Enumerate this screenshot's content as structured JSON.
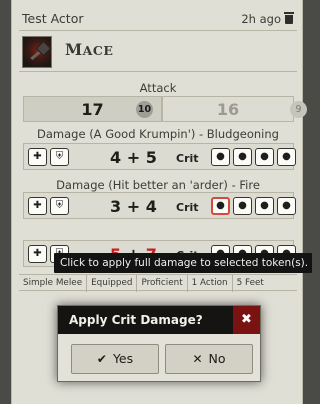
{
  "header": {
    "actor": "Test Actor",
    "time": "2h ago"
  },
  "item": {
    "name_first": "M",
    "name_rest": "ACE"
  },
  "attack": {
    "label": "Attack",
    "roll1_total": "17",
    "roll1_die": "10",
    "roll2_total": "16",
    "roll2_die": "9"
  },
  "damage1": {
    "label": "Damage (A Good Krumpin') - Bludgeoning",
    "total_a": "4",
    "total_b": "5",
    "crit_label": "Crit"
  },
  "damage2": {
    "label": "Damage (Hit better an 'arder) - Fire",
    "total_a": "3",
    "total_b": "4",
    "crit_label": "Crit"
  },
  "damage3": {
    "total_a": "5",
    "total_b": "7",
    "crit_label": "Crit"
  },
  "tooltip": "Click to apply full damage to selected token(s).",
  "tags": [
    "Simple Melee",
    "Equipped",
    "Proficient",
    "1 Action",
    "5 Feet"
  ],
  "dialog": {
    "title": "Apply Crit Damage?",
    "yes": "Yes",
    "no": "No",
    "close_glyph": "✖"
  },
  "icons": {
    "heal": "heart-plus-icon",
    "temp": "shield-heart-icon",
    "full": "user-full-damage-icon",
    "half": "user-half-damage-icon",
    "double": "user-double-damage-icon",
    "triple": "user-triple-damage-icon"
  },
  "colors": {
    "crit_red": "#c71f1f",
    "dialog_close": "#7a1212",
    "highlight": "#d44a3e"
  }
}
